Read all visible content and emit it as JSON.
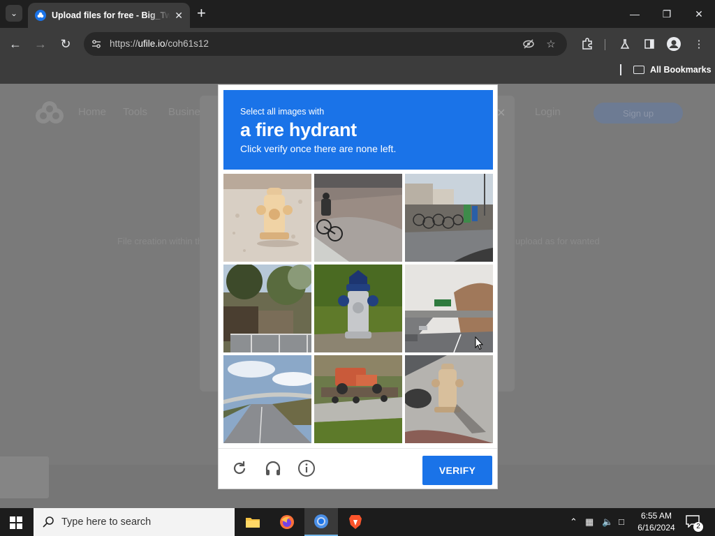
{
  "browser": {
    "tab_title": "Upload files for free - Big_Twent",
    "url_host": "ufile.io",
    "url_path": "/coh61s12",
    "url_scheme": "https://",
    "bookmarks_label": "All Bookmarks"
  },
  "page": {
    "nav": [
      "Home",
      "Tools",
      "Business",
      "Login",
      "Sign up"
    ],
    "text_left": "File creation within the",
    "text_right": "upload as for wanted"
  },
  "captcha": {
    "instruction_small": "Select all images with",
    "target": "a fire hydrant",
    "instruction_sub": "Click verify once there are none left.",
    "tiles": [
      "fire-hydrant-gravel",
      "cyclist-street",
      "bicycles-parking",
      "trees-fence",
      "blue-fire-hydrant",
      "highway-bridge",
      "highway-overpass",
      "tractor-trailer",
      "fire-hydrant-sidewalk"
    ],
    "verify_label": "VERIFY",
    "header_color": "#1a73e8"
  },
  "taskbar": {
    "search_placeholder": "Type here to search",
    "time": "6:55 AM",
    "date": "6/16/2024",
    "notifications": "2"
  }
}
